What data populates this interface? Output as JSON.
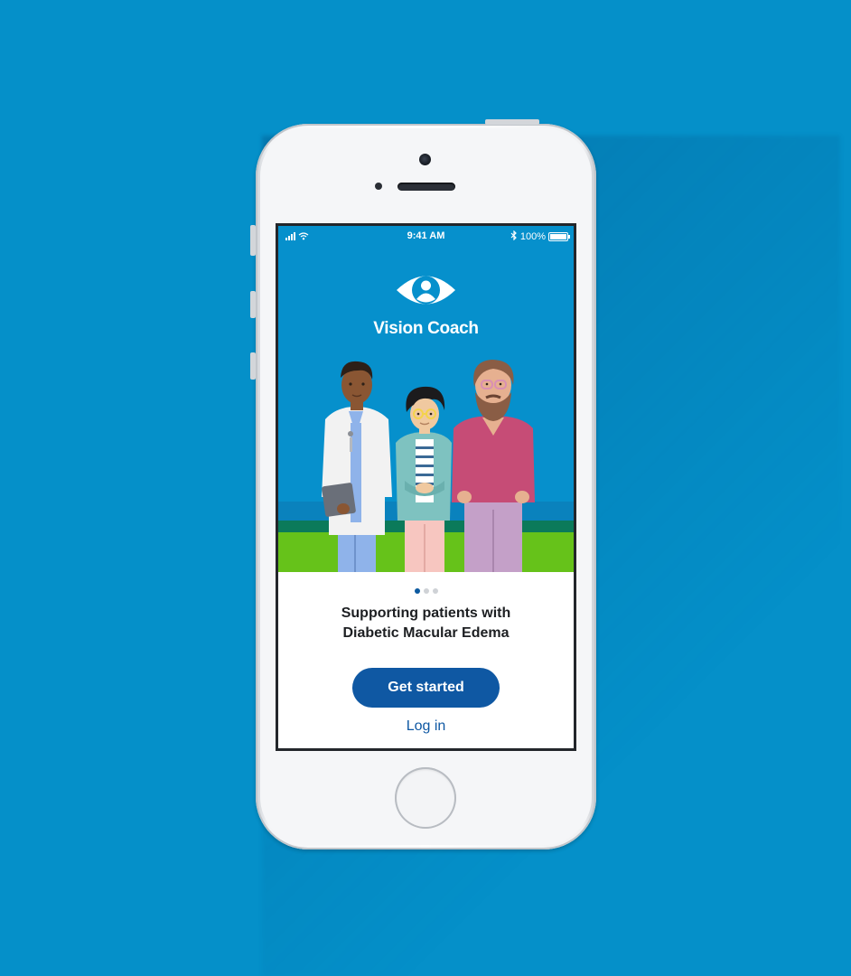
{
  "status_bar": {
    "time": "9:41 AM",
    "battery": "100%",
    "icons": [
      "signal-bars-icon",
      "wifi-icon",
      "bluetooth-icon",
      "battery-icon"
    ]
  },
  "app": {
    "name": "Vision Coach",
    "logo_icon": "eye-person-icon"
  },
  "onboarding": {
    "headline_line1": "Supporting patients with",
    "headline_line2": "Diabetic Macular Edema",
    "page_count": 3,
    "current_page": 1,
    "illustration": [
      "doctor-figure",
      "woman-figure",
      "bearded-man-figure"
    ]
  },
  "actions": {
    "primary_label": "Get started",
    "secondary_label": "Log in"
  },
  "colors": {
    "background": "#0590c9",
    "hero": "#0690cc",
    "primary": "#0f58a3",
    "grass": "#66c21a"
  }
}
